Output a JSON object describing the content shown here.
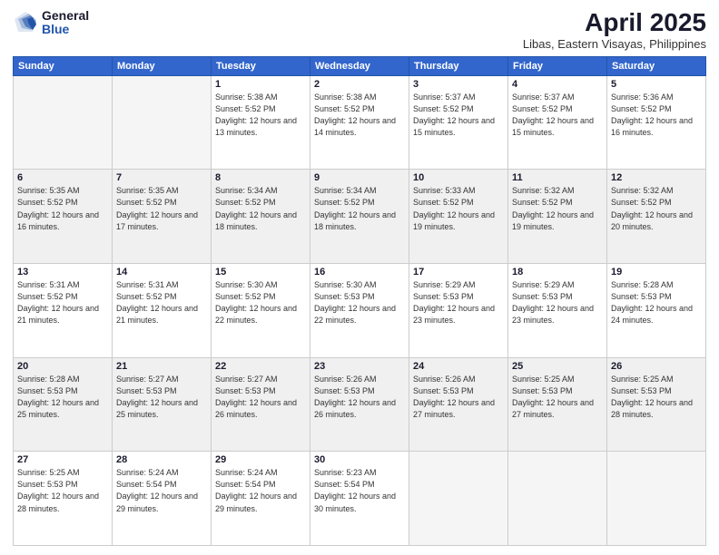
{
  "logo": {
    "general": "General",
    "blue": "Blue"
  },
  "title": "April 2025",
  "location": "Libas, Eastern Visayas, Philippines",
  "weekdays": [
    "Sunday",
    "Monday",
    "Tuesday",
    "Wednesday",
    "Thursday",
    "Friday",
    "Saturday"
  ],
  "weeks": [
    [
      {
        "day": "",
        "info": ""
      },
      {
        "day": "",
        "info": ""
      },
      {
        "day": "1",
        "info": "Sunrise: 5:38 AM\nSunset: 5:52 PM\nDaylight: 12 hours\nand 13 minutes."
      },
      {
        "day": "2",
        "info": "Sunrise: 5:38 AM\nSunset: 5:52 PM\nDaylight: 12 hours\nand 14 minutes."
      },
      {
        "day": "3",
        "info": "Sunrise: 5:37 AM\nSunset: 5:52 PM\nDaylight: 12 hours\nand 15 minutes."
      },
      {
        "day": "4",
        "info": "Sunrise: 5:37 AM\nSunset: 5:52 PM\nDaylight: 12 hours\nand 15 minutes."
      },
      {
        "day": "5",
        "info": "Sunrise: 5:36 AM\nSunset: 5:52 PM\nDaylight: 12 hours\nand 16 minutes."
      }
    ],
    [
      {
        "day": "6",
        "info": "Sunrise: 5:35 AM\nSunset: 5:52 PM\nDaylight: 12 hours\nand 16 minutes."
      },
      {
        "day": "7",
        "info": "Sunrise: 5:35 AM\nSunset: 5:52 PM\nDaylight: 12 hours\nand 17 minutes."
      },
      {
        "day": "8",
        "info": "Sunrise: 5:34 AM\nSunset: 5:52 PM\nDaylight: 12 hours\nand 18 minutes."
      },
      {
        "day": "9",
        "info": "Sunrise: 5:34 AM\nSunset: 5:52 PM\nDaylight: 12 hours\nand 18 minutes."
      },
      {
        "day": "10",
        "info": "Sunrise: 5:33 AM\nSunset: 5:52 PM\nDaylight: 12 hours\nand 19 minutes."
      },
      {
        "day": "11",
        "info": "Sunrise: 5:32 AM\nSunset: 5:52 PM\nDaylight: 12 hours\nand 19 minutes."
      },
      {
        "day": "12",
        "info": "Sunrise: 5:32 AM\nSunset: 5:52 PM\nDaylight: 12 hours\nand 20 minutes."
      }
    ],
    [
      {
        "day": "13",
        "info": "Sunrise: 5:31 AM\nSunset: 5:52 PM\nDaylight: 12 hours\nand 21 minutes."
      },
      {
        "day": "14",
        "info": "Sunrise: 5:31 AM\nSunset: 5:52 PM\nDaylight: 12 hours\nand 21 minutes."
      },
      {
        "day": "15",
        "info": "Sunrise: 5:30 AM\nSunset: 5:52 PM\nDaylight: 12 hours\nand 22 minutes."
      },
      {
        "day": "16",
        "info": "Sunrise: 5:30 AM\nSunset: 5:53 PM\nDaylight: 12 hours\nand 22 minutes."
      },
      {
        "day": "17",
        "info": "Sunrise: 5:29 AM\nSunset: 5:53 PM\nDaylight: 12 hours\nand 23 minutes."
      },
      {
        "day": "18",
        "info": "Sunrise: 5:29 AM\nSunset: 5:53 PM\nDaylight: 12 hours\nand 23 minutes."
      },
      {
        "day": "19",
        "info": "Sunrise: 5:28 AM\nSunset: 5:53 PM\nDaylight: 12 hours\nand 24 minutes."
      }
    ],
    [
      {
        "day": "20",
        "info": "Sunrise: 5:28 AM\nSunset: 5:53 PM\nDaylight: 12 hours\nand 25 minutes."
      },
      {
        "day": "21",
        "info": "Sunrise: 5:27 AM\nSunset: 5:53 PM\nDaylight: 12 hours\nand 25 minutes."
      },
      {
        "day": "22",
        "info": "Sunrise: 5:27 AM\nSunset: 5:53 PM\nDaylight: 12 hours\nand 26 minutes."
      },
      {
        "day": "23",
        "info": "Sunrise: 5:26 AM\nSunset: 5:53 PM\nDaylight: 12 hours\nand 26 minutes."
      },
      {
        "day": "24",
        "info": "Sunrise: 5:26 AM\nSunset: 5:53 PM\nDaylight: 12 hours\nand 27 minutes."
      },
      {
        "day": "25",
        "info": "Sunrise: 5:25 AM\nSunset: 5:53 PM\nDaylight: 12 hours\nand 27 minutes."
      },
      {
        "day": "26",
        "info": "Sunrise: 5:25 AM\nSunset: 5:53 PM\nDaylight: 12 hours\nand 28 minutes."
      }
    ],
    [
      {
        "day": "27",
        "info": "Sunrise: 5:25 AM\nSunset: 5:53 PM\nDaylight: 12 hours\nand 28 minutes."
      },
      {
        "day": "28",
        "info": "Sunrise: 5:24 AM\nSunset: 5:54 PM\nDaylight: 12 hours\nand 29 minutes."
      },
      {
        "day": "29",
        "info": "Sunrise: 5:24 AM\nSunset: 5:54 PM\nDaylight: 12 hours\nand 29 minutes."
      },
      {
        "day": "30",
        "info": "Sunrise: 5:23 AM\nSunset: 5:54 PM\nDaylight: 12 hours\nand 30 minutes."
      },
      {
        "day": "",
        "info": ""
      },
      {
        "day": "",
        "info": ""
      },
      {
        "day": "",
        "info": ""
      }
    ]
  ]
}
